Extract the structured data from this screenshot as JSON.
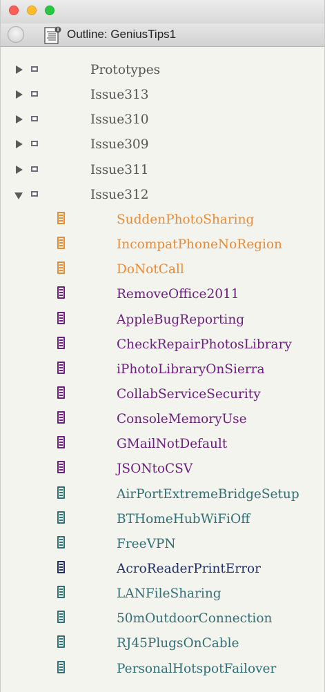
{
  "window": {
    "title": "Outline: GeniusTips1"
  },
  "colors": {
    "orange": "#ea8a32",
    "purple": "#6a1f7a",
    "teal": "#2f6f75",
    "navy": "#1f2f66",
    "group": "#555555"
  },
  "groups": [
    {
      "label": "Prototypes",
      "expanded": false
    },
    {
      "label": "Issue313",
      "expanded": false
    },
    {
      "label": "Issue310",
      "expanded": false
    },
    {
      "label": "Issue309",
      "expanded": false
    },
    {
      "label": "Issue311",
      "expanded": false
    },
    {
      "label": "Issue312",
      "expanded": true
    }
  ],
  "items": [
    {
      "label": "SuddenPhotoSharing",
      "color": "orange"
    },
    {
      "label": "IncompatPhoneNoRegion",
      "color": "orange"
    },
    {
      "label": "DoNotCall",
      "color": "orange"
    },
    {
      "label": "RemoveOffice2011",
      "color": "purple"
    },
    {
      "label": "AppleBugReporting",
      "color": "purple"
    },
    {
      "label": "CheckRepairPhotosLibrary",
      "color": "purple"
    },
    {
      "label": "iPhotoLibraryOnSierra",
      "color": "purple"
    },
    {
      "label": "CollabServiceSecurity",
      "color": "purple"
    },
    {
      "label": "ConsoleMemoryUse",
      "color": "purple"
    },
    {
      "label": "GMailNotDefault",
      "color": "purple"
    },
    {
      "label": "JSONtoCSV",
      "color": "purple"
    },
    {
      "label": "AirPortExtremeBridgeSetup",
      "color": "teal"
    },
    {
      "label": "BTHomeHubWiFiOff",
      "color": "teal"
    },
    {
      "label": "FreeVPN",
      "color": "teal"
    },
    {
      "label": "AcroReaderPrintError",
      "color": "navy"
    },
    {
      "label": "LANFileSharing",
      "color": "teal"
    },
    {
      "label": "50mOutdoorConnection",
      "color": "teal"
    },
    {
      "label": "RJ45PlugsOnCable",
      "color": "teal"
    },
    {
      "label": "PersonalHotspotFailover",
      "color": "teal"
    }
  ]
}
